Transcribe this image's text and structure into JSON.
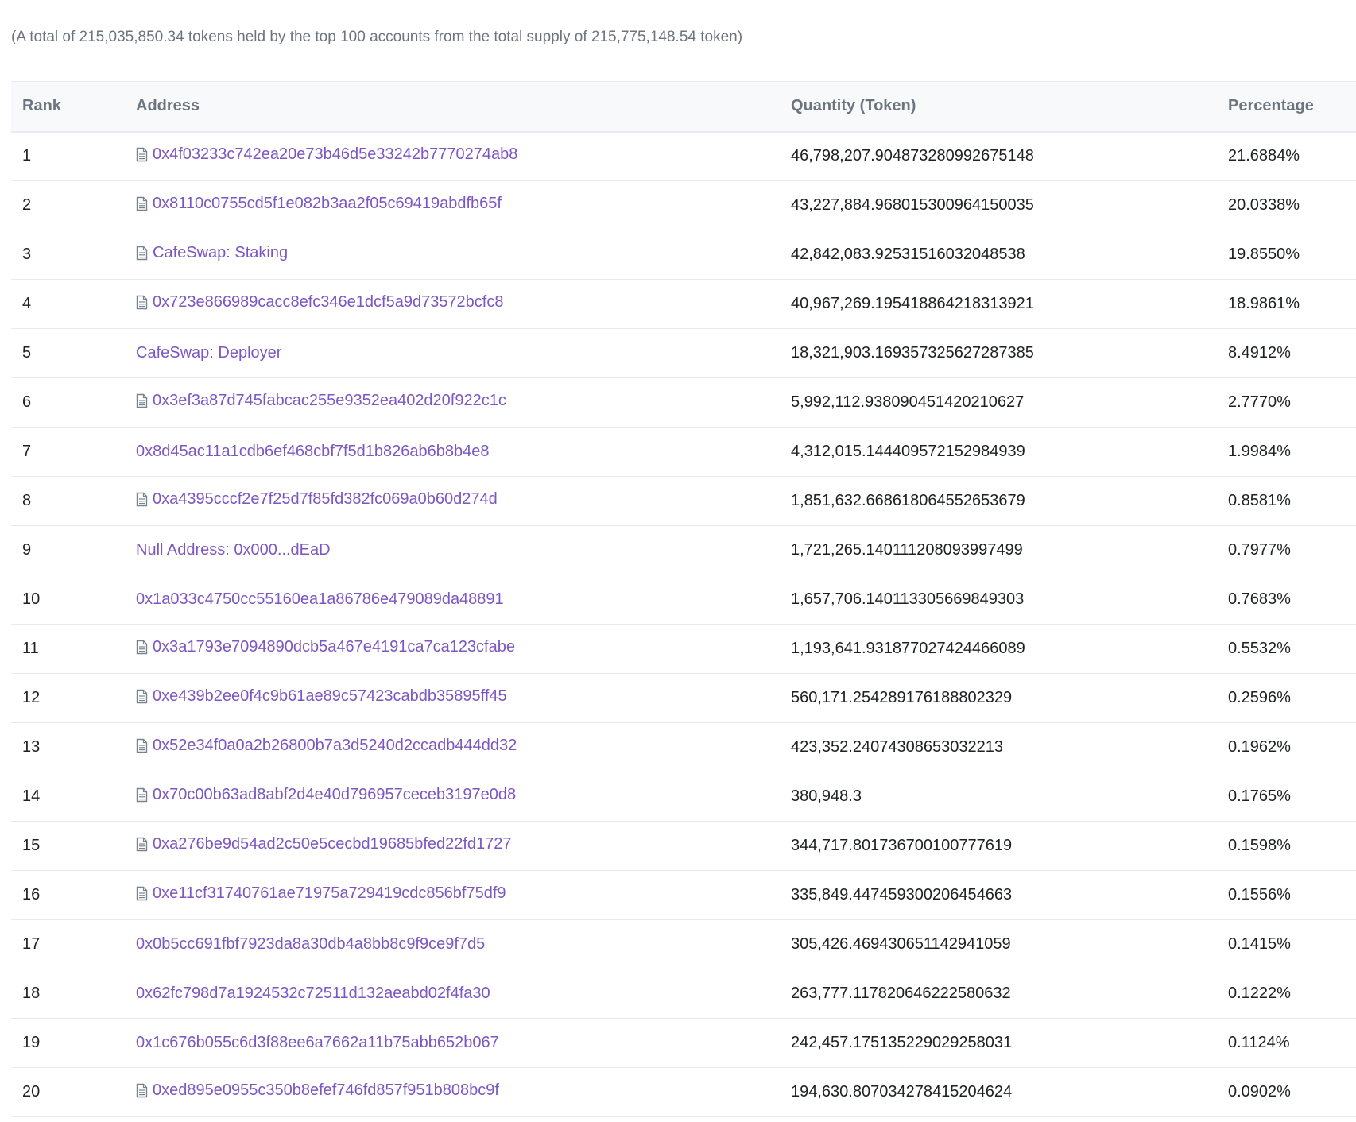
{
  "summary": "(A total of 215,035,850.34 tokens held by the top 100 accounts from the total supply of 215,775,148.54 token)",
  "table": {
    "headers": {
      "rank": "Rank",
      "address": "Address",
      "quantity": "Quantity (Token)",
      "percentage": "Percentage"
    },
    "rows": [
      {
        "rank": "1",
        "address": "0x4f03233c742ea20e73b46d5e33242b7770274ab8",
        "contract": true,
        "quantity": "46,798,207.904873280992675148",
        "percentage": "21.6884%"
      },
      {
        "rank": "2",
        "address": "0x8110c0755cd5f1e082b3aa2f05c69419abdfb65f",
        "contract": true,
        "quantity": "43,227,884.968015300964150035",
        "percentage": "20.0338%"
      },
      {
        "rank": "3",
        "address": "CafeSwap: Staking",
        "contract": true,
        "quantity": "42,842,083.92531516032048538",
        "percentage": "19.8550%"
      },
      {
        "rank": "4",
        "address": "0x723e866989cacc8efc346e1dcf5a9d73572bcfc8",
        "contract": true,
        "quantity": "40,967,269.195418864218313921",
        "percentage": "18.9861%"
      },
      {
        "rank": "5",
        "address": "CafeSwap: Deployer",
        "contract": false,
        "quantity": "18,321,903.169357325627287385",
        "percentage": "8.4912%"
      },
      {
        "rank": "6",
        "address": "0x3ef3a87d745fabcac255e9352ea402d20f922c1c",
        "contract": true,
        "quantity": "5,992,112.938090451420210627",
        "percentage": "2.7770%"
      },
      {
        "rank": "7",
        "address": "0x8d45ac11a1cdb6ef468cbf7f5d1b826ab6b8b4e8",
        "contract": false,
        "quantity": "4,312,015.144409572152984939",
        "percentage": "1.9984%"
      },
      {
        "rank": "8",
        "address": "0xa4395cccf2e7f25d7f85fd382fc069a0b60d274d",
        "contract": true,
        "quantity": "1,851,632.668618064552653679",
        "percentage": "0.8581%"
      },
      {
        "rank": "9",
        "address": "Null Address: 0x000...dEaD",
        "contract": false,
        "quantity": "1,721,265.140111208093997499",
        "percentage": "0.7977%"
      },
      {
        "rank": "10",
        "address": "0x1a033c4750cc55160ea1a86786e479089da48891",
        "contract": false,
        "quantity": "1,657,706.140113305669849303",
        "percentage": "0.7683%"
      },
      {
        "rank": "11",
        "address": "0x3a1793e7094890dcb5a467e4191ca7ca123cfabe",
        "contract": true,
        "quantity": "1,193,641.931877027424466089",
        "percentage": "0.5532%"
      },
      {
        "rank": "12",
        "address": "0xe439b2ee0f4c9b61ae89c57423cabdb35895ff45",
        "contract": true,
        "quantity": "560,171.254289176188802329",
        "percentage": "0.2596%"
      },
      {
        "rank": "13",
        "address": "0x52e34f0a0a2b26800b7a3d5240d2ccadb444dd32",
        "contract": true,
        "quantity": "423,352.24074308653032213",
        "percentage": "0.1962%"
      },
      {
        "rank": "14",
        "address": "0x70c00b63ad8abf2d4e40d796957ceceb3197e0d8",
        "contract": true,
        "quantity": "380,948.3",
        "percentage": "0.1765%"
      },
      {
        "rank": "15",
        "address": "0xa276be9d54ad2c50e5cecbd19685bfed22fd1727",
        "contract": true,
        "quantity": "344,717.801736700100777619",
        "percentage": "0.1598%"
      },
      {
        "rank": "16",
        "address": "0xe11cf31740761ae71975a729419cdc856bf75df9",
        "contract": true,
        "quantity": "335,849.447459300206454663",
        "percentage": "0.1556%"
      },
      {
        "rank": "17",
        "address": "0x0b5cc691fbf7923da8a30db4a8bb8c9f9ce9f7d5",
        "contract": false,
        "quantity": "305,426.469430651142941059",
        "percentage": "0.1415%"
      },
      {
        "rank": "18",
        "address": "0x62fc798d7a1924532c72511d132aeabd02f4fa30",
        "contract": false,
        "quantity": "263,777.117820646222580632",
        "percentage": "0.1222%"
      },
      {
        "rank": "19",
        "address": "0x1c676b055c6d3f88ee6a7662a11b75abb652b067",
        "contract": false,
        "quantity": "242,457.175135229029258031",
        "percentage": "0.1124%"
      },
      {
        "rank": "20",
        "address": "0xed895e0955c350b8efef746fd857f951b808bc9f",
        "contract": true,
        "quantity": "194,630.807034278415204624",
        "percentage": "0.0902%"
      }
    ]
  },
  "colors": {
    "link": "#7c57c2",
    "text": "#1e2022",
    "muted": "#6c757e",
    "border": "#e7eaf3"
  },
  "icons": {
    "contract": "document-icon"
  }
}
